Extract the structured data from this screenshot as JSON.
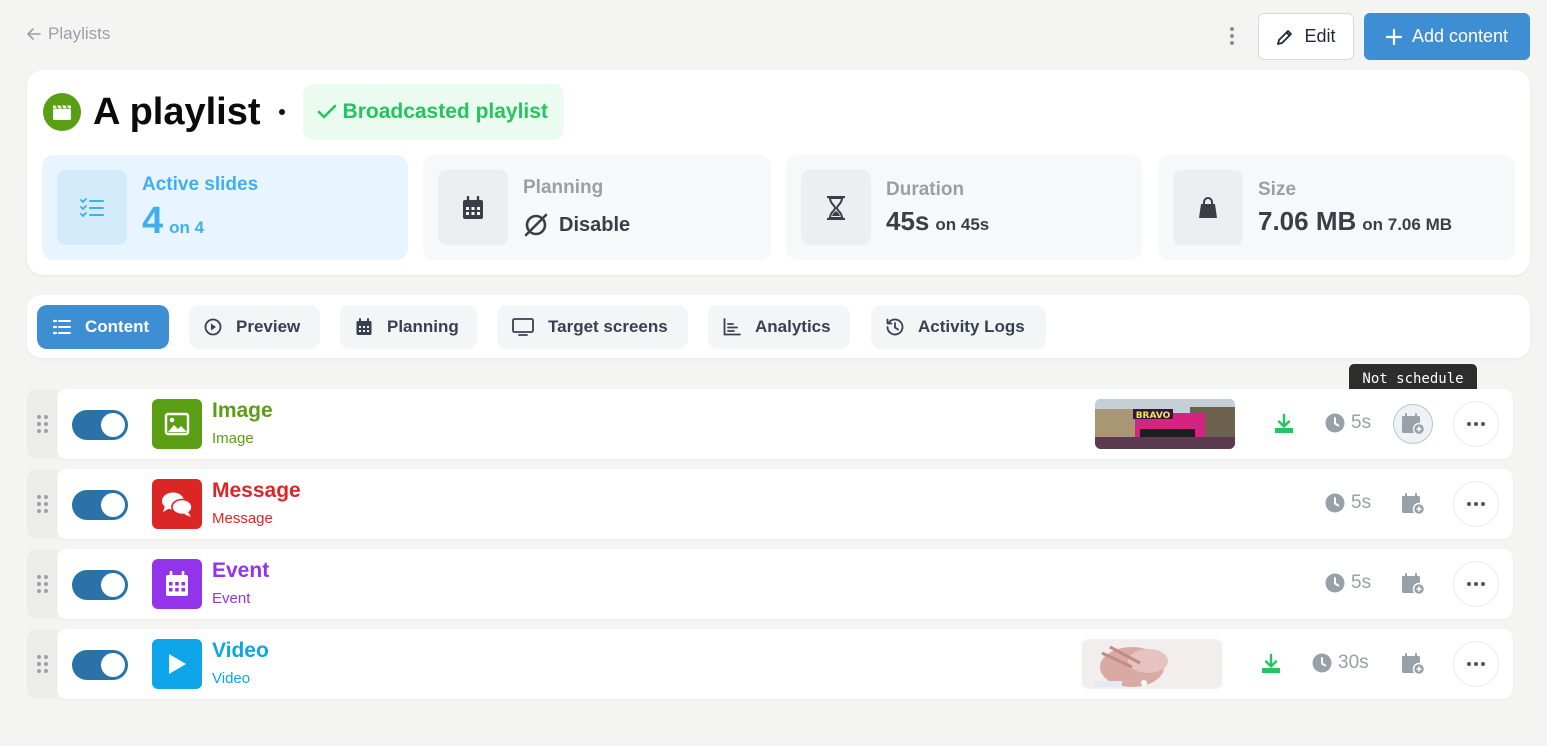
{
  "nav": {
    "back_label": "Playlists"
  },
  "toolbar": {
    "edit_label": "Edit",
    "add_label": "Add content"
  },
  "playlist": {
    "title": "A playlist",
    "status": "Broadcasted playlist"
  },
  "stats": {
    "active": {
      "label": "Active slides",
      "value": "4",
      "suffix": "on 4"
    },
    "planning": {
      "label": "Planning",
      "value": "Disable"
    },
    "duration": {
      "label": "Duration",
      "value": "45s",
      "suffix": "on 45s"
    },
    "size": {
      "label": "Size",
      "value": "7.06 MB",
      "suffix": "on 7.06 MB"
    }
  },
  "tabs": [
    {
      "label": "Content"
    },
    {
      "label": "Preview"
    },
    {
      "label": "Planning"
    },
    {
      "label": "Target screens"
    },
    {
      "label": "Analytics"
    },
    {
      "label": "Activity Logs"
    }
  ],
  "tooltip": "Not schedule",
  "items": [
    {
      "name": "Image",
      "type": "Image",
      "duration": "5s",
      "color": "#5a9e14",
      "enabled": true,
      "has_thumbnail": true
    },
    {
      "name": "Message",
      "type": "Message",
      "duration": "5s",
      "color": "#dc2626",
      "enabled": true,
      "has_thumbnail": false
    },
    {
      "name": "Event",
      "type": "Event",
      "duration": "5s",
      "color": "#9333ea",
      "enabled": true,
      "has_thumbnail": false
    },
    {
      "name": "Video",
      "type": "Video",
      "duration": "30s",
      "color": "#0ea5e9",
      "enabled": true,
      "has_thumbnail": true
    }
  ],
  "colors": {
    "accent": "#3e8ed4",
    "success": "#22c55e",
    "active_stat": "#3fb0ee"
  }
}
